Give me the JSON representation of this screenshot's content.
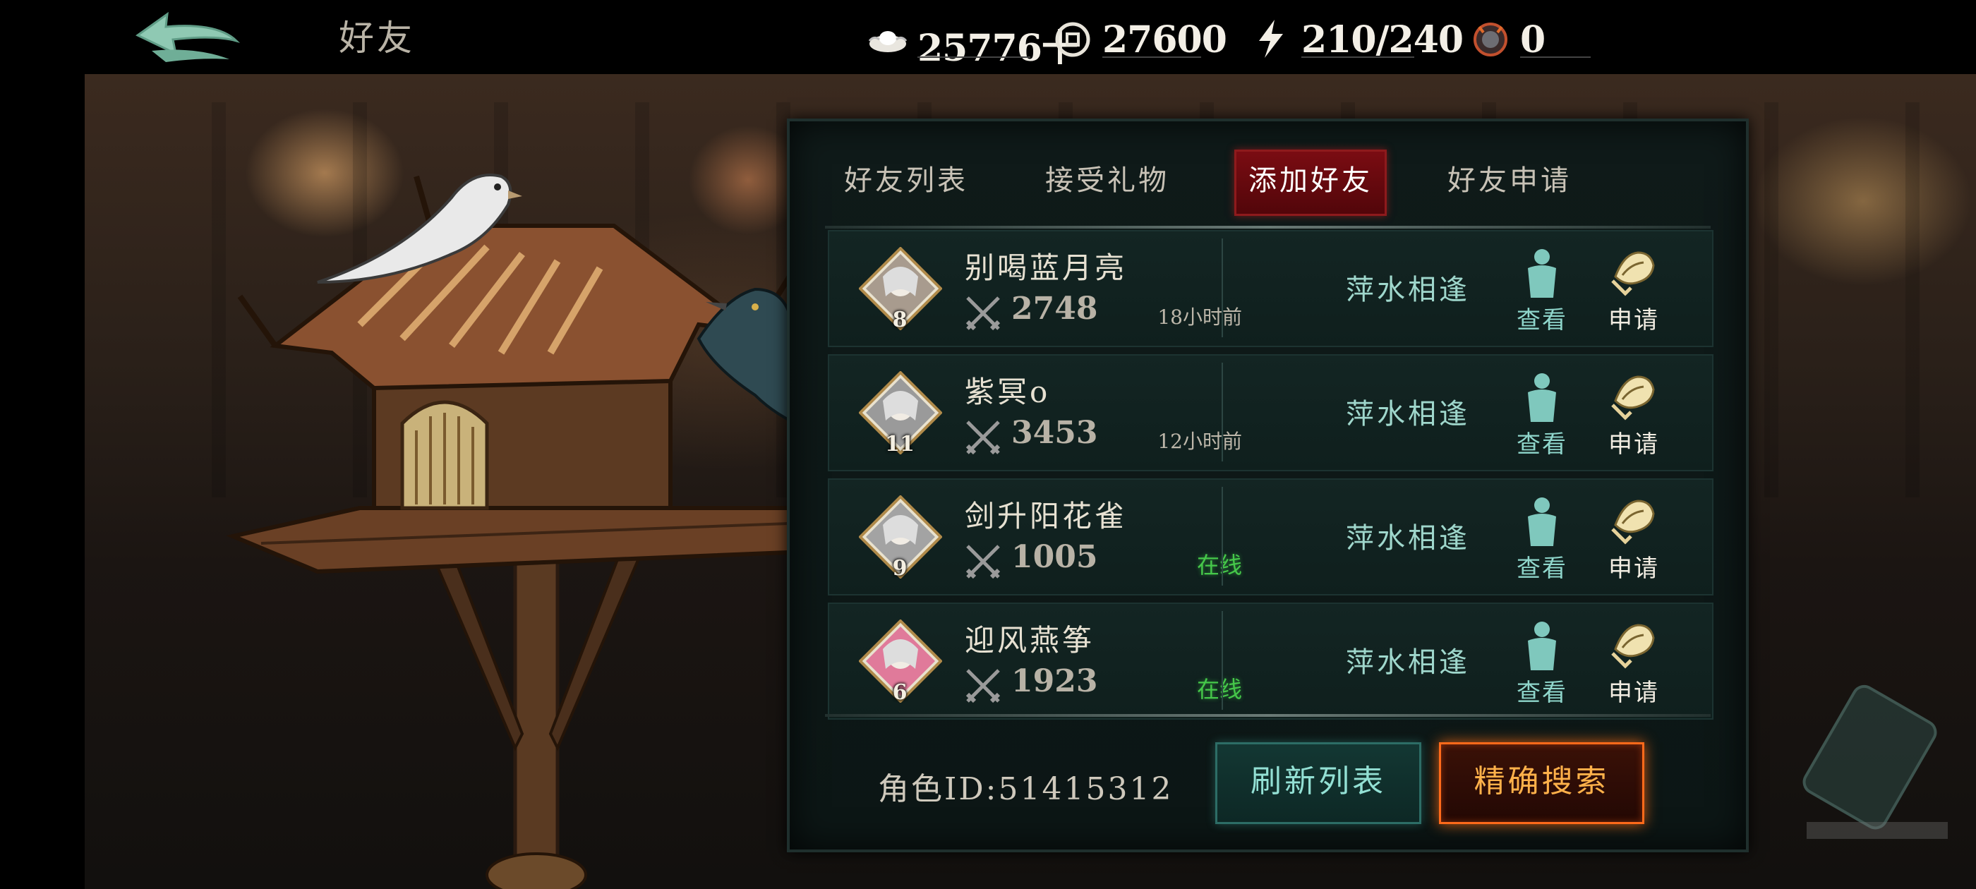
{
  "header": {
    "title": "好友",
    "resources": [
      {
        "icon": "silver-ingot-icon",
        "value": "25776十"
      },
      {
        "icon": "coin-icon",
        "value": "27600"
      },
      {
        "icon": "lightning-stamina-icon",
        "value": "210/240"
      },
      {
        "icon": "demon-token-icon",
        "value": "0"
      }
    ]
  },
  "tabs": [
    {
      "label": "好友列表",
      "active": false
    },
    {
      "label": "接受礼物",
      "active": false
    },
    {
      "label": "添加好友",
      "active": true
    },
    {
      "label": "好友申请",
      "active": false
    }
  ],
  "players": [
    {
      "name": "别喝蓝月亮",
      "level": "8",
      "power": "2748",
      "status": "18小时前",
      "online": false,
      "relation": "萍水相逢",
      "view": "查看",
      "apply": "申请",
      "avatar_color": "#a89b8e"
    },
    {
      "name": "紫冥o",
      "level": "11",
      "power": "3453",
      "status": "12小时前",
      "online": false,
      "relation": "萍水相逢",
      "view": "查看",
      "apply": "申请",
      "avatar_color": "#9a9a9a"
    },
    {
      "name": "剑升阳花雀",
      "level": "9",
      "power": "1005",
      "status": "在线",
      "online": true,
      "relation": "萍水相逢",
      "view": "查看",
      "apply": "申请",
      "avatar_color": "#a3a3a3"
    },
    {
      "name": "迎风燕筝",
      "level": "6",
      "power": "1923",
      "status": "在线",
      "online": true,
      "relation": "萍水相逢",
      "view": "查看",
      "apply": "申请",
      "avatar_color": "#e07a9a"
    }
  ],
  "footer": {
    "role_id": "角色ID:51415312",
    "refresh_label": "刷新列表",
    "search_label": "精确搜索"
  },
  "colors": {
    "active_tab": "#7a0c12",
    "online": "#46c84a",
    "relation": "#9fd7cc",
    "search_glow": "#ff6a1a"
  }
}
